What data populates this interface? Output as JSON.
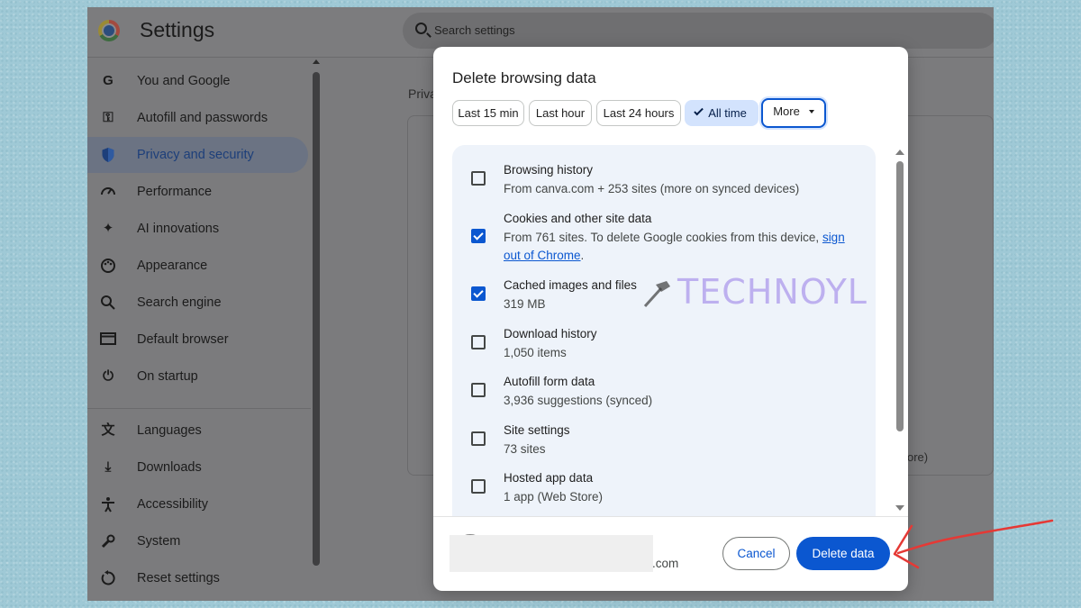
{
  "app": {
    "title": "Settings",
    "search_placeholder": "Search settings"
  },
  "sidebar": {
    "items": [
      {
        "label": "You and Google",
        "icon": "google-g-icon",
        "active": false
      },
      {
        "label": "Autofill and passwords",
        "icon": "key-icon",
        "active": false
      },
      {
        "label": "Privacy and security",
        "icon": "shield-icon",
        "active": true
      },
      {
        "label": "Performance",
        "icon": "speedometer-icon",
        "active": false
      },
      {
        "label": "AI innovations",
        "icon": "sparkle-icon",
        "active": false
      },
      {
        "label": "Appearance",
        "icon": "palette-icon",
        "active": false
      },
      {
        "label": "Search engine",
        "icon": "search-icon",
        "active": false
      },
      {
        "label": "Default browser",
        "icon": "browser-window-icon",
        "active": false
      },
      {
        "label": "On startup",
        "icon": "power-icon",
        "active": false
      },
      {
        "label": "Languages",
        "icon": "translate-icon",
        "active": false
      },
      {
        "label": "Downloads",
        "icon": "download-icon",
        "active": false
      },
      {
        "label": "Accessibility",
        "icon": "accessibility-icon",
        "active": false
      },
      {
        "label": "System",
        "icon": "wrench-icon",
        "active": false
      },
      {
        "label": "Reset settings",
        "icon": "reset-icon",
        "active": false
      }
    ]
  },
  "content": {
    "section_title_partial": "Priva",
    "peek_text": "ore)"
  },
  "dialog": {
    "title": "Delete browsing data",
    "time_ranges": [
      {
        "label": "Last 15 min",
        "selected": false
      },
      {
        "label": "Last hour",
        "selected": false
      },
      {
        "label": "Last 24 hours",
        "selected": false
      },
      {
        "label": "All time",
        "selected": true
      },
      {
        "label": "More",
        "selected": false
      }
    ],
    "items": [
      {
        "label": "Browsing history",
        "desc": "From canva.com + 253 sites (more on synced devices)",
        "checked": false
      },
      {
        "label": "Cookies and other site data",
        "desc": "From 761 sites. To delete Google cookies from this device,",
        "link_a": "sign",
        "link_b": "out of Chrome",
        "desc_end": ".",
        "checked": true
      },
      {
        "label": "Cached images and files",
        "desc": "319 MB",
        "checked": true
      },
      {
        "label": "Download history",
        "desc": "1,050 items",
        "checked": false
      },
      {
        "label": "Autofill form data",
        "desc": "3,936 suggestions (synced)",
        "checked": false
      },
      {
        "label": "Site settings",
        "desc": "73 sites",
        "checked": false
      },
      {
        "label": "Hosted app data",
        "desc": "1 app (Web Store)",
        "checked": false
      }
    ],
    "account_email_suffix": ".com",
    "cancel_label": "Cancel",
    "delete_label": "Delete data"
  },
  "watermark": {
    "text": "TECHNOYL"
  },
  "annotation": {
    "arrow_color": "#e53935"
  },
  "colors": {
    "accent": "#0b57d0",
    "selected_chip": "#d3e3fd",
    "panel": "#eef3fa"
  }
}
